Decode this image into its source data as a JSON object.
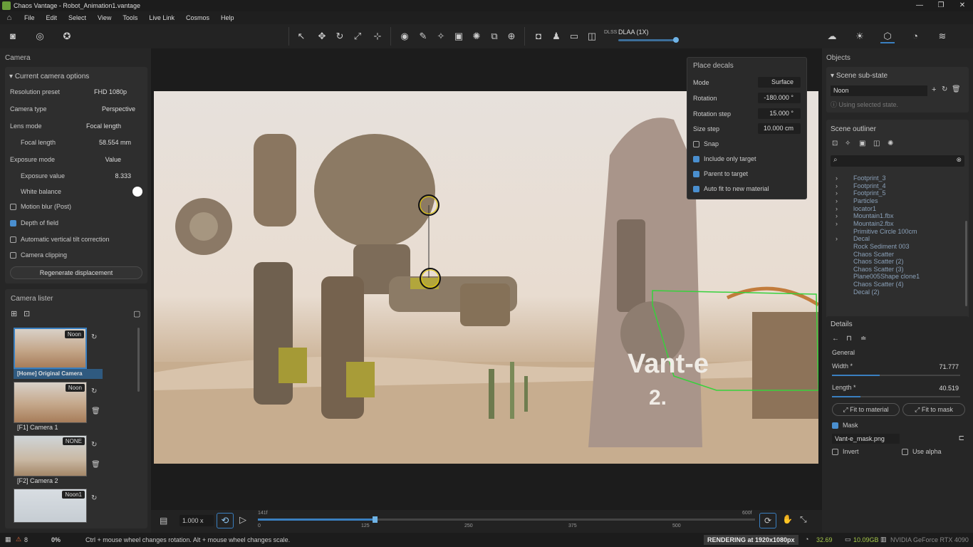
{
  "window": {
    "title": "Chaos Vantage - Robot_Animation1.vantage"
  },
  "menu": [
    "File",
    "Edit",
    "Select",
    "View",
    "Tools",
    "Live Link",
    "Cosmos",
    "Help"
  ],
  "toolbar": {
    "dlaa": "DLAA (1X)",
    "dlss": "DLSS"
  },
  "camera": {
    "panel_title": "Camera",
    "section": "Current camera options",
    "resolution_label": "Resolution preset",
    "resolution": "FHD 1080p",
    "type_label": "Camera type",
    "type": "Perspective",
    "lens_label": "Lens mode",
    "lens": "Focal length",
    "focal_label": "Focal length",
    "focal": "58.554 mm",
    "exposure_mode_label": "Exposure mode",
    "exposure_mode": "Value",
    "exposure_value_label": "Exposure value",
    "exposure_value": "8.333",
    "white_balance": "White balance",
    "motion_blur": "Motion blur (Post)",
    "dof": "Depth of field",
    "vertical_tilt": "Automatic vertical tilt correction",
    "clipping": "Camera clipping",
    "regen": "Regenerate displacement"
  },
  "lister": {
    "title": "Camera lister",
    "cameras": [
      {
        "tag": "Noon",
        "label": "[Home] Original Camera"
      },
      {
        "tag": "Noon",
        "label": "[F1] Camera 1"
      },
      {
        "tag": "NONE",
        "label": "[F2] Camera 2"
      },
      {
        "tag": "Noon1",
        "label": ""
      }
    ]
  },
  "decals": {
    "title": "Place decals",
    "mode_label": "Mode",
    "mode": "Surface",
    "rotation_label": "Rotation",
    "rotation": "-180.000 °",
    "rotation_step_label": "Rotation step",
    "rotation_step": "15.000 °",
    "size_step_label": "Size step",
    "size_step": "10.000 cm",
    "snap": "Snap",
    "include": "Include only target",
    "parent": "Parent to target",
    "autofit": "Auto fit to new material"
  },
  "viewport": {
    "decal_text1": "Vant-e",
    "decal_text2": "2."
  },
  "timeline": {
    "speed": "1.000 x",
    "current": "141f",
    "end": "600f",
    "ticks": [
      "0",
      "125",
      "250",
      "375",
      "500"
    ],
    "progress": 0.235
  },
  "objects": {
    "title": "Objects",
    "substate_title": "Scene sub-state",
    "substate": "Noon",
    "substate_note": "Using selected state.",
    "outliner_title": "Scene outliner",
    "items": [
      "Footprint_3",
      "Footprint_4",
      "Footprint_5",
      "Particles",
      "locator1",
      "Mountain1.fbx",
      "Mountain2.fbx",
      "Primitive Circle 100cm",
      "Decal",
      "Rock Sediment 003",
      "Chaos Scatter",
      "Chaos Scatter (2)",
      "Chaos Scatter (3)",
      "Plane005Shape clone1",
      "Chaos Scatter (4)",
      "Decal (2)"
    ]
  },
  "details": {
    "title": "Details",
    "general": "General",
    "width_label": "Width *",
    "width": "71.777",
    "length_label": "Length *",
    "length": "40.519",
    "fit_material": "Fit to material",
    "fit_mask": "Fit to mask",
    "mask": "Mask",
    "mask_file": "Vant-e_mask.png",
    "invert": "Invert",
    "use_alpha": "Use alpha"
  },
  "status": {
    "warnings": "8",
    "progress": "0%",
    "hint": "Ctrl + mouse wheel changes rotation. Alt + mouse wheel changes scale.",
    "rendering": "RENDERING at 1920x1080px",
    "fps": "32.69",
    "mem": "10.09GB",
    "gpu": "NVIDIA GeForce RTX 4090"
  }
}
